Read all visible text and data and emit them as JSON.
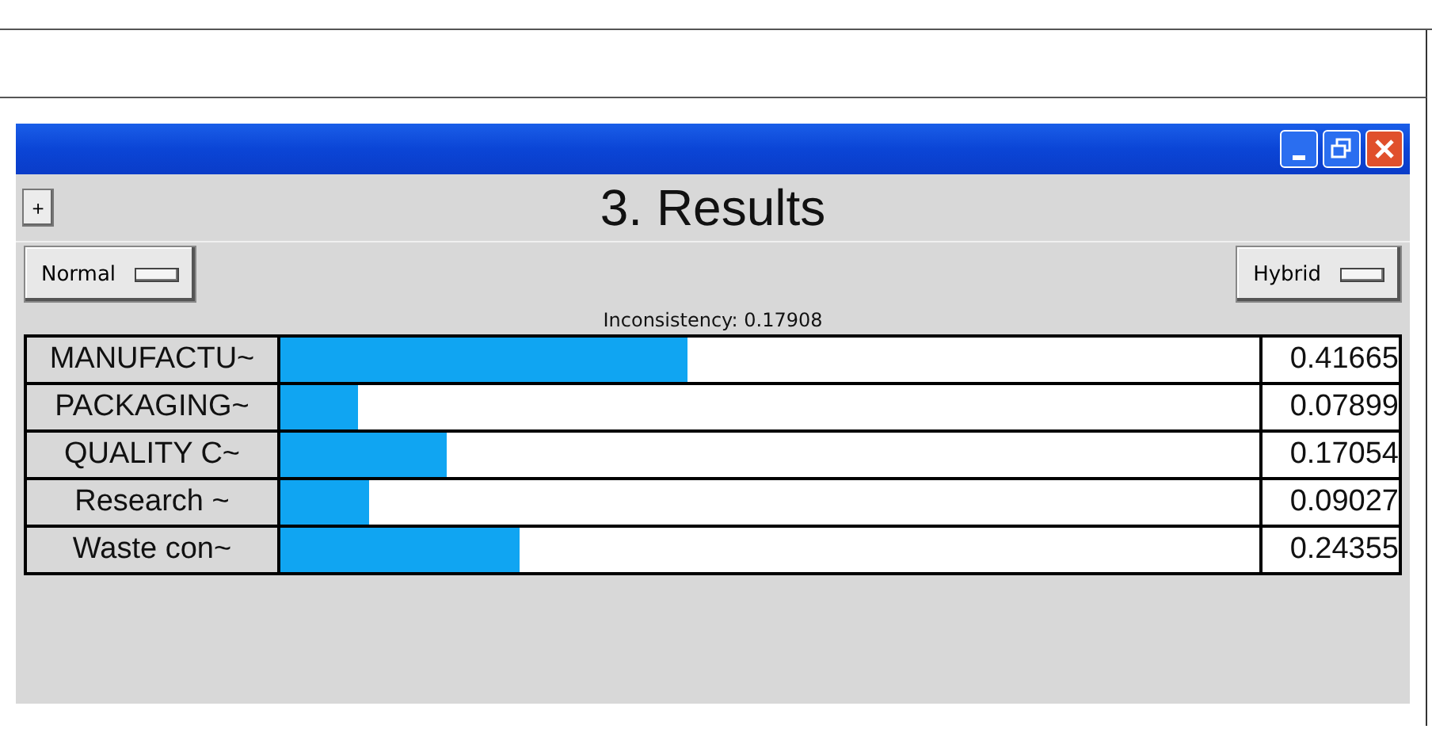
{
  "window": {
    "title": "3. Results",
    "expand_button": "+"
  },
  "modes": [
    {
      "label": "Normal"
    },
    {
      "label": "Hybrid"
    }
  ],
  "inconsistency": "Inconsistency: 0.17908",
  "results": [
    {
      "name": "MANUFACTU~",
      "level": 0.41665,
      "value": "0.41665"
    },
    {
      "name": "PACKAGING~",
      "level": 0.07899,
      "value": "0.07899"
    },
    {
      "name": "QUALITY C~",
      "level": 0.17054,
      "value": "0.17054"
    },
    {
      "name": "Research ~",
      "level": 0.09027,
      "value": "0.09027"
    },
    {
      "name": "Waste con~",
      "level": 0.24355,
      "value": "0.24355"
    }
  ]
}
